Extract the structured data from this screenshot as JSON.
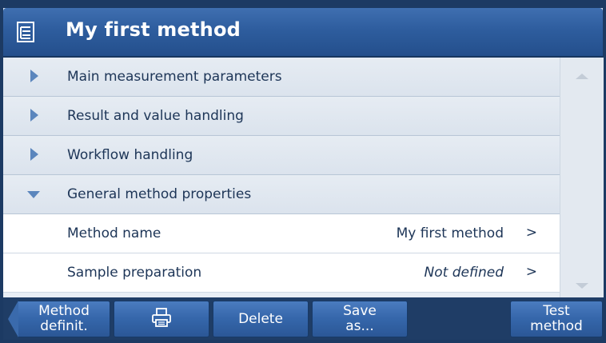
{
  "header": {
    "title": "My first method",
    "icon": "method-list-icon"
  },
  "list": {
    "groups": [
      {
        "label": "Main measurement parameters",
        "expanded": false
      },
      {
        "label": "Result and value handling",
        "expanded": false
      },
      {
        "label": "Workflow handling",
        "expanded": false
      },
      {
        "label": "General method properties",
        "expanded": true
      }
    ],
    "items": [
      {
        "label": "Method name",
        "value": "My first method",
        "chevron": ">"
      },
      {
        "label": "Sample preparation",
        "value": "Not defined",
        "chevron": ">"
      }
    ]
  },
  "toolbar": {
    "back_line1": "Method",
    "back_line2": "definit.",
    "print_icon": "printer-icon",
    "delete_label": "Delete",
    "save_line1": "Save",
    "save_line2": "as...",
    "test_line1": "Test",
    "test_line2": "method"
  },
  "colors": {
    "header": "#2e5d9e",
    "accent_arrow": "#5b86bd",
    "button": "#3566aa",
    "text": "#1d3557"
  }
}
